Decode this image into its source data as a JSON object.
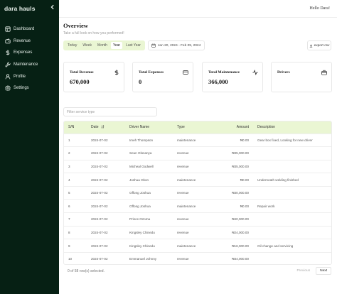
{
  "sidebar": {
    "brand": "dara hauls",
    "collapse_icon": "chevron-left-icon",
    "items": [
      {
        "label": "Dashboard",
        "icon": "dashboard-icon"
      },
      {
        "label": "Revenue",
        "icon": "wallet-icon"
      },
      {
        "label": "Expenses",
        "icon": "dollar-icon"
      },
      {
        "label": "Maintenance",
        "icon": "wrench-icon"
      },
      {
        "label": "Profile",
        "icon": "user-icon"
      },
      {
        "label": "Settings",
        "icon": "gear-icon"
      }
    ]
  },
  "header": {
    "greeting": "Hello Dara!",
    "title": "Overview",
    "subtitle": "Take a full look on how you performed!"
  },
  "tabs": [
    {
      "label": "Today",
      "active": false
    },
    {
      "label": "Week",
      "active": false
    },
    {
      "label": "Month",
      "active": false
    },
    {
      "label": "Year",
      "active": true
    },
    {
      "label": "Last Year",
      "active": false
    }
  ],
  "daterange": {
    "label": "Jan 20, 2024 - Feb 09, 2024",
    "icon": "calendar-icon"
  },
  "export": {
    "label": "export csv",
    "icon": "download-icon"
  },
  "cards": [
    {
      "label": "Total Revenue",
      "value": "670,000",
      "icon": "dollar-icon"
    },
    {
      "label": "Total Expenses",
      "value": "0",
      "icon": "credit-card-icon"
    },
    {
      "label": "Total Maintenance",
      "value": "366,000",
      "icon": "activity-icon"
    },
    {
      "label": "Drivers",
      "value": "",
      "icon": "briefcase-icon"
    }
  ],
  "filter": {
    "placeholder": "Filter service type"
  },
  "table": {
    "columns": [
      "S/N",
      "Date",
      "Driver Name",
      "Type",
      "Amount",
      "Description"
    ],
    "rows": [
      [
        "1",
        "2024-07-02",
        "Imeh Thompson",
        "maintenance",
        "₦0.00",
        "Gear box fixed, Looking for new driver"
      ],
      [
        "2",
        "2024-07-02",
        "Seun Olosanya",
        "revenue",
        "₦35,000.00",
        ""
      ],
      [
        "3",
        "2024-07-02",
        "Micheal Godwell",
        "revenue",
        "₦35,000.00",
        ""
      ],
      [
        "4",
        "2024-07-02",
        "Joshua Okon",
        "maintenance",
        "₦0.00",
        "Underneath welding finished"
      ],
      [
        "5",
        "2024-07-02",
        "Offong Joshua",
        "revenue",
        "₦30,000.00",
        ""
      ],
      [
        "6",
        "2024-07-02",
        "Offong Joshua",
        "maintenance",
        "₦0.00",
        "Repair work"
      ],
      [
        "7",
        "2024-07-02",
        "Prince Ozoma",
        "revenue",
        "₦40,000.00",
        ""
      ],
      [
        "8",
        "2024-07-02",
        "Kingsley Chinedu",
        "revenue",
        "₦24,000.00",
        ""
      ],
      [
        "9",
        "2024-07-02",
        "Kingsley Chinedu",
        "maintenance",
        "₦16,000.00",
        "Oil change and servicing"
      ],
      [
        "10",
        "2024-07-02",
        "Emmanuel Johnny",
        "revenue",
        "₦34,000.00",
        ""
      ]
    ]
  },
  "footer": {
    "selection_text": "0 of 58 row(s) selected.",
    "prev_label": "Previous",
    "next_label": "Next"
  }
}
